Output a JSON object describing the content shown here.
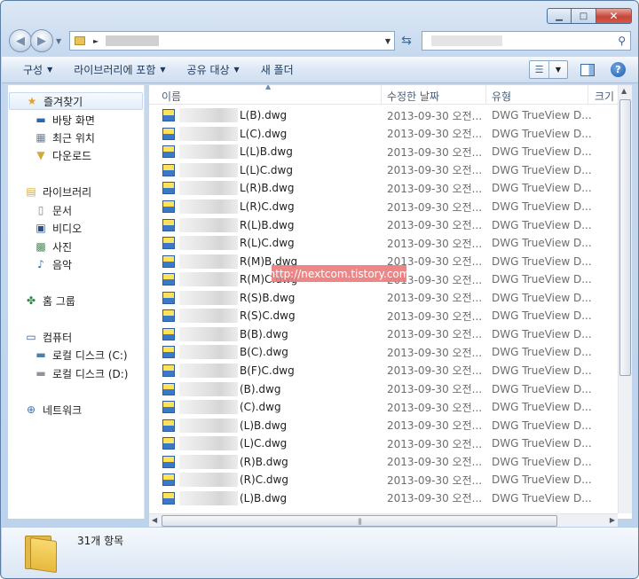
{
  "window": {
    "caption": {
      "minimize": "▁",
      "maximize": "□",
      "close": "✕"
    }
  },
  "address": {
    "path_arrow": "►"
  },
  "toolbar": {
    "items": [
      "구성",
      "라이브러리에 포함",
      "공유 대상",
      "새 폴더"
    ]
  },
  "nav": {
    "favorites": {
      "label": "즐겨찾기",
      "items": [
        "바탕 화면",
        "최근 위치",
        "다운로드"
      ]
    },
    "libraries": {
      "label": "라이브러리",
      "items": [
        "문서",
        "비디오",
        "사진",
        "음악"
      ]
    },
    "homegroup": {
      "label": "홈 그룹"
    },
    "computer": {
      "label": "컴퓨터",
      "items": [
        "로컬 디스크 (C:)",
        "로컬 디스크 (D:)"
      ]
    },
    "network": {
      "label": "네트워크"
    }
  },
  "columns": {
    "name": "이름",
    "modified": "수정한 날짜",
    "type": "유형",
    "size": "크기"
  },
  "files": [
    {
      "name": "L(B).dwg",
      "date": "2013-09-30 오전...",
      "type": "DWG TrueView D..."
    },
    {
      "name": "L(C).dwg",
      "date": "2013-09-30 오전...",
      "type": "DWG TrueView D..."
    },
    {
      "name": "L(L)B.dwg",
      "date": "2013-09-30 오전...",
      "type": "DWG TrueView D..."
    },
    {
      "name": "L(L)C.dwg",
      "date": "2013-09-30 오전...",
      "type": "DWG TrueView D..."
    },
    {
      "name": "L(R)B.dwg",
      "date": "2013-09-30 오전...",
      "type": "DWG TrueView D..."
    },
    {
      "name": "L(R)C.dwg",
      "date": "2013-09-30 오전...",
      "type": "DWG TrueView D..."
    },
    {
      "name": "R(L)B.dwg",
      "date": "2013-09-30 오전...",
      "type": "DWG TrueView D..."
    },
    {
      "name": "R(L)C.dwg",
      "date": "2013-09-30 오전...",
      "type": "DWG TrueView D..."
    },
    {
      "name": "R(M)B.dwg",
      "date": "2013-09-30 오전...",
      "type": "DWG TrueView D..."
    },
    {
      "name": "R(M)C.dwg",
      "date": "2013-09-30 오전...",
      "type": "DWG TrueView D..."
    },
    {
      "name": "R(S)B.dwg",
      "date": "2013-09-30 오전...",
      "type": "DWG TrueView D..."
    },
    {
      "name": "R(S)C.dwg",
      "date": "2013-09-30 오전...",
      "type": "DWG TrueView D..."
    },
    {
      "name": "B(B).dwg",
      "date": "2013-09-30 오전...",
      "type": "DWG TrueView D..."
    },
    {
      "name": "B(C).dwg",
      "date": "2013-09-30 오전...",
      "type": "DWG TrueView D..."
    },
    {
      "name": "B(F)C.dwg",
      "date": "2013-09-30 오전...",
      "type": "DWG TrueView D..."
    },
    {
      "name": "(B).dwg",
      "date": "2013-09-30 오전...",
      "type": "DWG TrueView D..."
    },
    {
      "name": "(C).dwg",
      "date": "2013-09-30 오전...",
      "type": "DWG TrueView D..."
    },
    {
      "name": "(L)B.dwg",
      "date": "2013-09-30 오전...",
      "type": "DWG TrueView D..."
    },
    {
      "name": "(L)C.dwg",
      "date": "2013-09-30 오전...",
      "type": "DWG TrueView D..."
    },
    {
      "name": "(R)B.dwg",
      "date": "2013-09-30 오전...",
      "type": "DWG TrueView D..."
    },
    {
      "name": "(R)C.dwg",
      "date": "2013-09-30 오전...",
      "type": "DWG TrueView D..."
    },
    {
      "name": "(L)B.dwg",
      "date": "2013-09-30 오전...",
      "type": "DWG TrueView D..."
    }
  ],
  "watermark": "http://nextcom.tistory.com",
  "status": {
    "count": "31개 항목"
  },
  "icons": {
    "back": "back-arrow-icon",
    "forward": "forward-arrow-icon",
    "refresh": "refresh-icon",
    "search": "search-icon",
    "file": "dwg-file-icon",
    "folder": "folder-icon",
    "help": "help-icon"
  }
}
